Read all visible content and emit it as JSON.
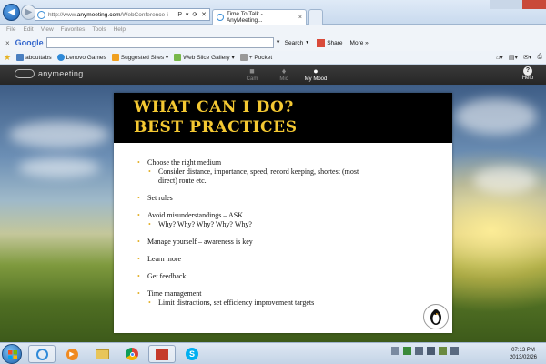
{
  "browser": {
    "url_prefix": "http://www.",
    "url_domain": "anymeeting.com",
    "url_rest": "/WebConference-i",
    "address_tools": "P ▾ ⟳ ✕",
    "tab_title": "Time To Talk - AnyMeeting...",
    "tab_close": "×",
    "menu": [
      "File",
      "Edit",
      "View",
      "Favorites",
      "Tools",
      "Help"
    ]
  },
  "google_toolbar": {
    "close": "×",
    "logo": "Google",
    "search_value": "",
    "search_label": "Search",
    "share_label": "Share",
    "more_label": "More »"
  },
  "favorites": {
    "items": [
      "abouttabs",
      "Lenovo Games",
      "Suggested Sites ▾",
      "Web Slice Gallery ▾",
      "+ Pocket"
    ]
  },
  "app": {
    "logo_text": "anymeeting",
    "controls": [
      {
        "label": "Cam",
        "glyph": "■"
      },
      {
        "label": "Mic",
        "glyph": "♦"
      },
      {
        "label": "My Mood",
        "glyph": "●"
      },
      {
        "label": "Help",
        "glyph": "?"
      }
    ]
  },
  "slide": {
    "title_line1": "WHAT CAN I DO?",
    "title_line2": "BEST PRACTICES",
    "bullets": [
      {
        "text": "Choose the right medium",
        "subs": [
          "Consider distance, importance, speed, record keeping, shortest (most",
          "direct) route etc."
        ]
      },
      {
        "text": "Set rules",
        "subs": []
      },
      {
        "text": "Avoid misunderstandings – ASK",
        "subs": [
          "Why? Why? Why? Why? Why?"
        ]
      },
      {
        "text": "Manage yourself – awareness is key",
        "subs": []
      },
      {
        "text": "Learn more",
        "subs": []
      },
      {
        "text": "Get feedback",
        "subs": []
      },
      {
        "text": "Time management",
        "subs": [
          "Limit distractions, set efficiency  improvement targets"
        ]
      }
    ],
    "bullet_glyph": "•",
    "accent_color": "#f4c832"
  },
  "taskbar": {
    "time": "07:13 PM",
    "date": "2013/02/26"
  }
}
